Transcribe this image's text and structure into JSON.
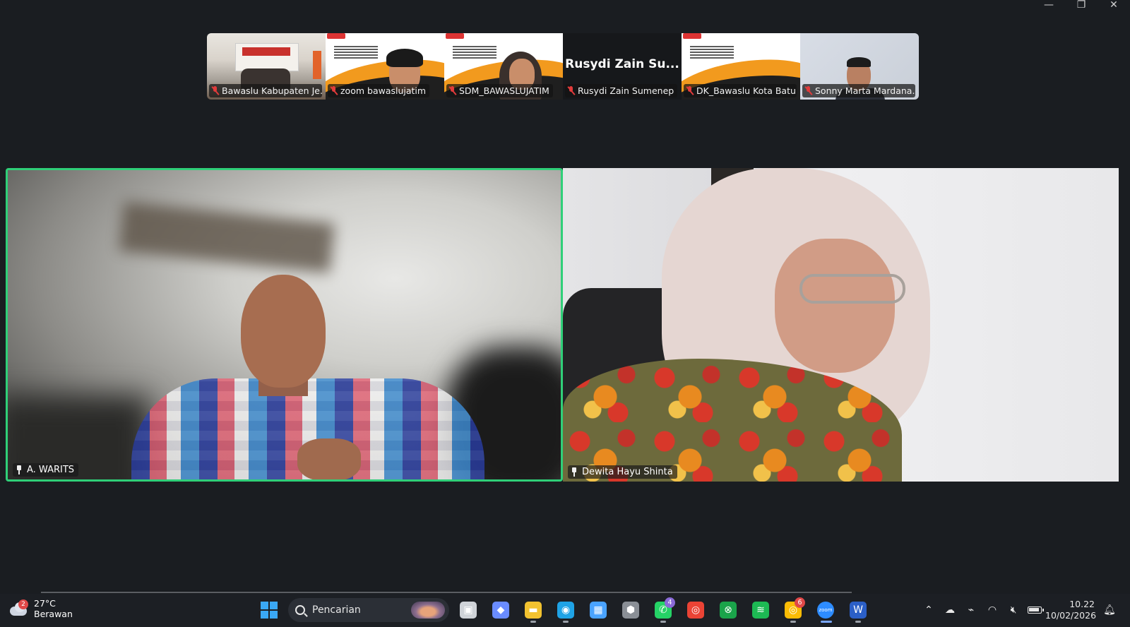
{
  "window": {
    "minimize": "—",
    "restore": "❐",
    "close": "✕"
  },
  "thumbnails": [
    {
      "name": "Bawaslu Kabupaten Je...",
      "muted": true,
      "kind": "room"
    },
    {
      "name": "zoom bawaslujatim",
      "muted": true,
      "kind": "slide-man"
    },
    {
      "name": "SDM_BAWASLUJATIM",
      "muted": true,
      "kind": "slide-woman"
    },
    {
      "name": "Rusydi Zain Sumenep",
      "display_name": "Rusydi Zain Su...",
      "muted": true,
      "kind": "no-video"
    },
    {
      "name": "DK_Bawaslu Kota Batu",
      "muted": true,
      "kind": "slide"
    },
    {
      "name": "Sonny Marta Mardana...",
      "muted": true,
      "kind": "camera"
    }
  ],
  "main_tiles": [
    {
      "name": "A. WARITS",
      "pinned": true,
      "active_speaker": true
    },
    {
      "name": "Dewita Hayu Shinta",
      "pinned": true,
      "active_speaker": false
    }
  ],
  "taskbar": {
    "weather": {
      "badge": "2",
      "temp": "27°C",
      "condition": "Berawan"
    },
    "search_placeholder": "Pencarian",
    "apps": [
      {
        "id": "task-view",
        "glyph": "▣",
        "color": "#cfd3d8"
      },
      {
        "id": "copilot",
        "glyph": "◆",
        "color": "#6a8cff"
      },
      {
        "id": "file-explorer",
        "glyph": "▬",
        "color": "#f2c230",
        "running": true
      },
      {
        "id": "edge",
        "glyph": "◉",
        "color": "#1fa3e6",
        "running": true
      },
      {
        "id": "microsoft-store",
        "glyph": "▦",
        "color": "#4aa3ff"
      },
      {
        "id": "unity",
        "glyph": "⬢",
        "color": "#8a8f96"
      },
      {
        "id": "whatsapp",
        "glyph": "✆",
        "color": "#25d366",
        "badge": "4",
        "badge_color": "#8a6ad8",
        "running": true
      },
      {
        "id": "chrome",
        "glyph": "◎",
        "color": "#ea4335"
      },
      {
        "id": "xbox",
        "glyph": "⊗",
        "color": "#1aa34a"
      },
      {
        "id": "spotify",
        "glyph": "≋",
        "color": "#1db954"
      },
      {
        "id": "chrome-profile",
        "glyph": "◎",
        "color": "#fbbc05",
        "badge": "6",
        "badge_color": "#e04848",
        "running": true
      },
      {
        "id": "zoom",
        "glyph": "zoom",
        "color": "#2d8cff",
        "running": true,
        "active": true
      },
      {
        "id": "word",
        "glyph": "W",
        "color": "#2b5fc7",
        "running": true
      }
    ],
    "tray": {
      "chevron": "⌃",
      "time": "10.22",
      "date": "10/02/2026"
    }
  }
}
